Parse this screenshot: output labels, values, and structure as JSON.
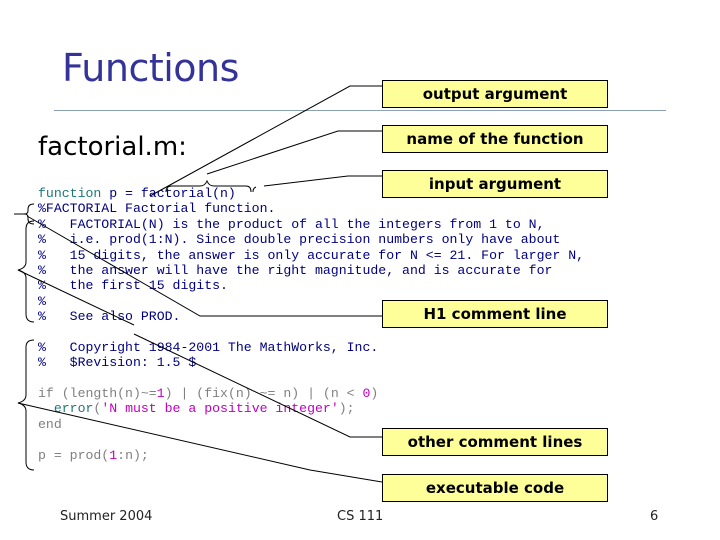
{
  "slide": {
    "title": "Functions",
    "filename_label": "factorial.m:",
    "code_lines": [
      [
        {
          "t": "function",
          "c": "kw"
        },
        {
          "t": " p = factorial(n)",
          "c": "plain"
        }
      ],
      [
        {
          "t": "%FACTORIAL Factorial function.",
          "c": "plain"
        }
      ],
      [
        {
          "t": "%   FACTORIAL(N) is the product of all the integers from 1 to N,",
          "c": "plain"
        }
      ],
      [
        {
          "t": "%   i.e. prod(1:N). Since double precision numbers only have about",
          "c": "plain"
        }
      ],
      [
        {
          "t": "%   15 digits, the answer is only accurate for N <= 21. For larger N,",
          "c": "plain"
        }
      ],
      [
        {
          "t": "%   the answer will have the right magnitude, and is accurate for",
          "c": "plain"
        }
      ],
      [
        {
          "t": "%   the first 15 digits.",
          "c": "plain"
        }
      ],
      [
        {
          "t": "%",
          "c": "plain"
        }
      ],
      [
        {
          "t": "%   See also PROD.",
          "c": "plain"
        }
      ],
      [
        {
          "t": "",
          "c": "plain"
        }
      ],
      [
        {
          "t": "%   Copyright 1984-2001 The MathWorks, Inc.",
          "c": "plain"
        }
      ],
      [
        {
          "t": "%   $Revision: 1.5 $",
          "c": "plain"
        }
      ],
      [
        {
          "t": "",
          "c": "plain"
        }
      ],
      [
        {
          "t": "if",
          "c": "gr"
        },
        {
          "t": " (length(n)~=",
          "c": "gr"
        },
        {
          "t": "1",
          "c": "num"
        },
        {
          "t": ") | (fix(n) ~= n) | (n < ",
          "c": "gr"
        },
        {
          "t": "0",
          "c": "num"
        },
        {
          "t": ")",
          "c": "gr"
        }
      ],
      [
        {
          "t": "  ",
          "c": "plain"
        },
        {
          "t": "error",
          "c": "kw"
        },
        {
          "t": "(",
          "c": "gr"
        },
        {
          "t": "'N must be a positive integer'",
          "c": "str"
        },
        {
          "t": ");",
          "c": "gr"
        }
      ],
      [
        {
          "t": "end",
          "c": "gr"
        }
      ],
      [
        {
          "t": "",
          "c": "plain"
        }
      ],
      [
        {
          "t": "p = prod(",
          "c": "gr"
        },
        {
          "t": "1",
          "c": "num"
        },
        {
          "t": ":n);",
          "c": "gr"
        }
      ]
    ],
    "callouts": {
      "output_argument": "output argument",
      "function_name": "name of the function",
      "input_argument": "input argument",
      "h1_comment": "H1 comment line",
      "other_comments": "other comment lines",
      "executable_code": "executable code"
    },
    "footer": {
      "left": "Summer 2004",
      "center": "CS 111",
      "page_number": "6"
    },
    "colors": {
      "title": "#333399",
      "callout_fill": "#ffff99",
      "comment_text": "#000080",
      "keyword": "#1e7878",
      "string": "#c000c0"
    }
  }
}
